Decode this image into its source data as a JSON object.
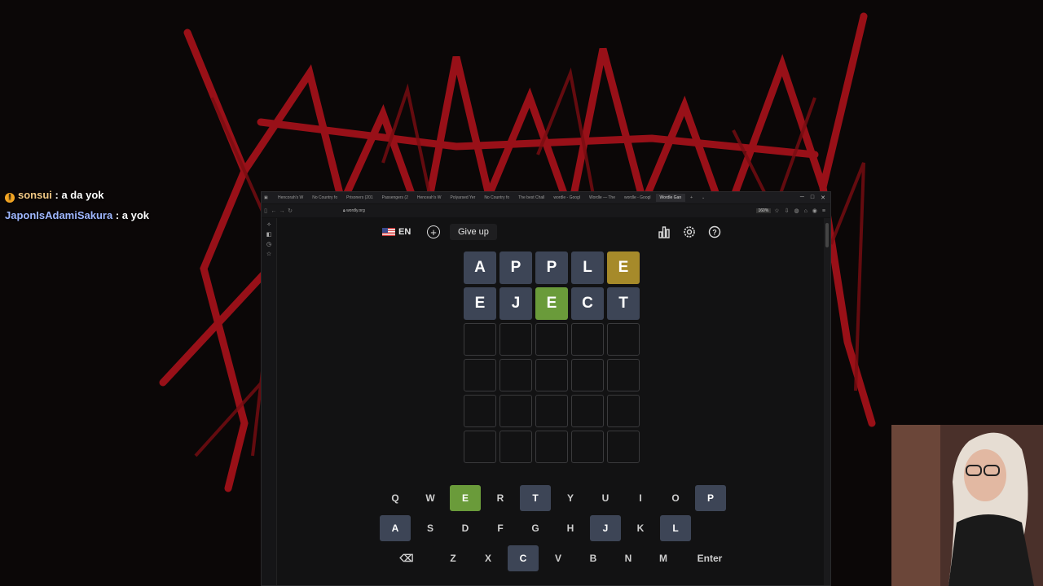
{
  "chat": [
    {
      "name": "sonsui",
      "message": " : a da yok",
      "has_badge": true
    },
    {
      "name": "JaponIsAdamiSakura",
      "message": " : a yok",
      "has_badge": false
    }
  ],
  "browser": {
    "tabs": [
      "Hencorah's W",
      "No Country fo",
      "Prisoners (201",
      "Passengers (2",
      "Henceah's W",
      "Polyarsed Yer",
      "No Country fo",
      "The best Chall",
      "wordle - Googl",
      "Wordle — The",
      "wordle - Googl",
      "Wordle Gan"
    ],
    "url": "wordly.org",
    "zoom": "160%"
  },
  "game": {
    "lang": "EN",
    "give_up": "Give up",
    "rows": [
      [
        {
          "l": "A",
          "s": "absent"
        },
        {
          "l": "P",
          "s": "absent"
        },
        {
          "l": "P",
          "s": "absent"
        },
        {
          "l": "L",
          "s": "absent"
        },
        {
          "l": "E",
          "s": "present"
        }
      ],
      [
        {
          "l": "E",
          "s": "absent"
        },
        {
          "l": "J",
          "s": "absent"
        },
        {
          "l": "E",
          "s": "correct"
        },
        {
          "l": "C",
          "s": "absent"
        },
        {
          "l": "T",
          "s": "absent"
        }
      ],
      [
        {
          "l": "",
          "s": "empty"
        },
        {
          "l": "",
          "s": "empty"
        },
        {
          "l": "",
          "s": "empty"
        },
        {
          "l": "",
          "s": "empty"
        },
        {
          "l": "",
          "s": "empty"
        }
      ],
      [
        {
          "l": "",
          "s": "empty"
        },
        {
          "l": "",
          "s": "empty"
        },
        {
          "l": "",
          "s": "empty"
        },
        {
          "l": "",
          "s": "empty"
        },
        {
          "l": "",
          "s": "empty"
        }
      ],
      [
        {
          "l": "",
          "s": "empty"
        },
        {
          "l": "",
          "s": "empty"
        },
        {
          "l": "",
          "s": "empty"
        },
        {
          "l": "",
          "s": "empty"
        },
        {
          "l": "",
          "s": "empty"
        }
      ],
      [
        {
          "l": "",
          "s": "empty"
        },
        {
          "l": "",
          "s": "empty"
        },
        {
          "l": "",
          "s": "empty"
        },
        {
          "l": "",
          "s": "empty"
        },
        {
          "l": "",
          "s": "empty"
        }
      ]
    ],
    "keyboard": [
      [
        {
          "k": "Q",
          "s": ""
        },
        {
          "k": "W",
          "s": ""
        },
        {
          "k": "E",
          "s": "correct"
        },
        {
          "k": "R",
          "s": ""
        },
        {
          "k": "T",
          "s": "absent"
        },
        {
          "k": "Y",
          "s": ""
        },
        {
          "k": "U",
          "s": ""
        },
        {
          "k": "I",
          "s": ""
        },
        {
          "k": "O",
          "s": ""
        },
        {
          "k": "P",
          "s": "absent"
        }
      ],
      [
        {
          "k": "A",
          "s": "absent"
        },
        {
          "k": "S",
          "s": ""
        },
        {
          "k": "D",
          "s": ""
        },
        {
          "k": "F",
          "s": ""
        },
        {
          "k": "G",
          "s": ""
        },
        {
          "k": "H",
          "s": ""
        },
        {
          "k": "J",
          "s": "absent"
        },
        {
          "k": "K",
          "s": ""
        },
        {
          "k": "L",
          "s": "absent"
        }
      ],
      [
        {
          "k": "⌫",
          "s": "",
          "wide": true,
          "name": "backspace-key"
        },
        {
          "k": "Z",
          "s": ""
        },
        {
          "k": "X",
          "s": ""
        },
        {
          "k": "C",
          "s": "absent"
        },
        {
          "k": "V",
          "s": ""
        },
        {
          "k": "B",
          "s": ""
        },
        {
          "k": "N",
          "s": ""
        },
        {
          "k": "M",
          "s": ""
        },
        {
          "k": "Enter",
          "s": "",
          "wide": true,
          "name": "enter-key"
        }
      ]
    ]
  },
  "colors": {
    "absent": "#3d4556",
    "present": "#a68a2a",
    "correct": "#6a9b3a",
    "background_art": "#b3121b"
  }
}
